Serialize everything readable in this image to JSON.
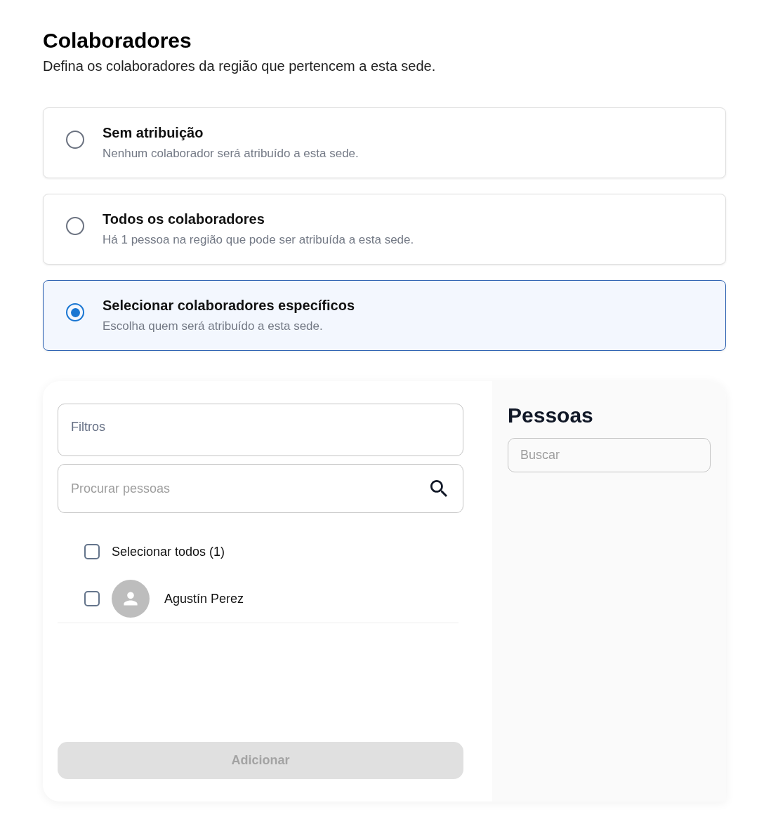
{
  "header": {
    "title": "Colaboradores",
    "subtitle": "Defina os colaboradores da região que pertencem a esta sede."
  },
  "options": [
    {
      "title": "Sem atribuição",
      "description": "Nenhum colaborador será atribuído a esta sede.",
      "selected": false
    },
    {
      "title": "Todos os colaboradores",
      "description": "Há 1 pessoa na região que pode ser atribuída a esta sede.",
      "selected": false
    },
    {
      "title": "Selecionar colaboradores específicos",
      "description": "Escolha quem será atribuído a esta sede.",
      "selected": true
    }
  ],
  "picker": {
    "filters": {
      "label": "Filtros"
    },
    "search": {
      "placeholder": "Procurar pessoas"
    },
    "select_all": {
      "label": "Selecionar todos (1)",
      "checked": false
    },
    "people": [
      {
        "name": "Agustín Perez",
        "checked": false
      }
    ],
    "add_button": {
      "label": "Adicionar",
      "disabled": true
    }
  },
  "selected_panel": {
    "title": "Pessoas",
    "search": {
      "placeholder": "Buscar"
    }
  }
}
